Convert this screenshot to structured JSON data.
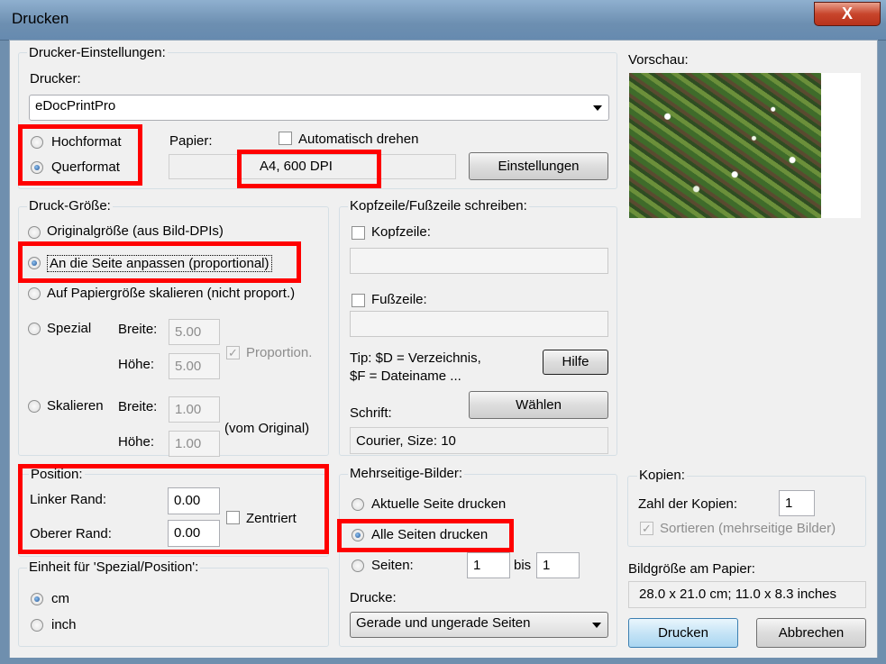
{
  "window": {
    "title": "Drucken",
    "close_glyph": "X"
  },
  "printer_settings": {
    "legend": "Drucker-Einstellungen:",
    "printer_label": "Drucker:",
    "printer_value": "eDocPrintPro",
    "orientation_portrait": "Hochformat",
    "orientation_landscape": "Querformat",
    "paper_label": "Papier:",
    "auto_rotate": "Automatisch drehen",
    "paper_value": "A4,        600 DPI",
    "settings_button": "Einstellungen"
  },
  "preview": {
    "label": "Vorschau:"
  },
  "print_size": {
    "legend": "Druck-Größe:",
    "original": "Originalgröße (aus Bild-DPIs)",
    "fit_page": "An die Seite anpassen (proportional)",
    "scale_paper": "Auf Papiergröße skalieren (nicht proport.)",
    "special": "Spezial",
    "width_label": "Breite:",
    "height_label": "Höhe:",
    "special_width": "5.00",
    "special_height": "5.00",
    "proportion": "Proportion.",
    "scale": "Skalieren",
    "scale_width": "1.00",
    "scale_height": "1.00",
    "from_original": "(vom Original)"
  },
  "header_footer": {
    "legend": "Kopfzeile/Fußzeile schreiben:",
    "header": "Kopfzeile:",
    "footer": "Fußzeile:",
    "tip_line1": "Tip: $D = Verzeichnis,",
    "tip_line2": "$F = Dateiname ...",
    "help_button": "Hilfe",
    "font_label": "Schrift:",
    "choose_button": "Wählen",
    "font_value": "Courier, Size: 10"
  },
  "position": {
    "legend": "Position:",
    "left_margin_label": "Linker Rand:",
    "left_margin": "0.00",
    "top_margin_label": "Oberer Rand:",
    "top_margin": "0.00",
    "centered": "Zentriert"
  },
  "units": {
    "legend": "Einheit für 'Spezial/Position':",
    "cm": "cm",
    "inch": "inch"
  },
  "multipage": {
    "legend": "Mehrseitige-Bilder:",
    "current_page": "Aktuelle Seite drucken",
    "all_pages": "Alle Seiten drucken",
    "pages": "Seiten:",
    "from": "1",
    "to_label": "bis",
    "to": "1",
    "prints_label": "Drucke:",
    "prints_value": "Gerade und ungerade Seiten"
  },
  "copies": {
    "legend": "Kopien:",
    "count_label": "Zahl der Kopien:",
    "count": "1",
    "sort": "Sortieren (mehrseitige Bilder)"
  },
  "image_size": {
    "label": "Bildgröße am Papier:",
    "value": "28.0 x 21.0 cm; 11.0 x 8.3 inches"
  },
  "buttons": {
    "print": "Drucken",
    "cancel": "Abbrechen"
  }
}
